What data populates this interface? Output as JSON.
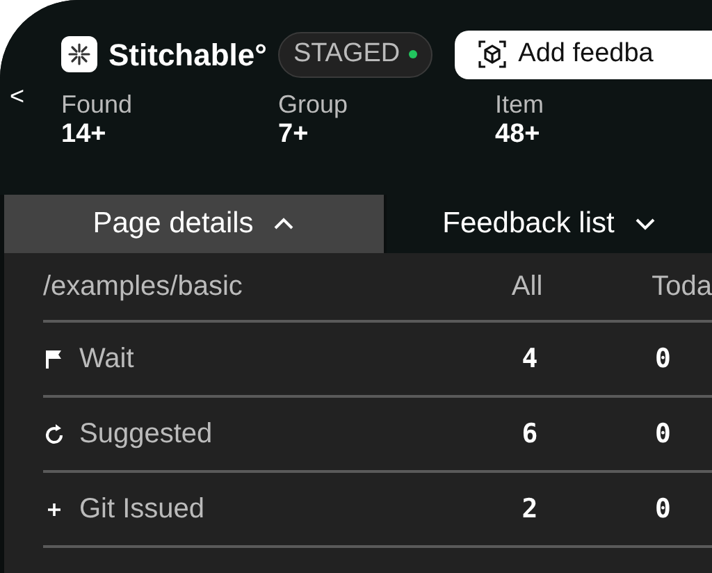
{
  "header": {
    "back_symbol": "<",
    "app_name": "Stitchable°",
    "badge": {
      "label": "STAGED",
      "color": "#22c55e"
    },
    "add_button": "Add feedba"
  },
  "stats": [
    {
      "label": "Found",
      "value": "14+"
    },
    {
      "label": "Group",
      "value": "7+"
    },
    {
      "label": "Item",
      "value": "48+"
    }
  ],
  "tabs": [
    {
      "label": "Page details",
      "selected": true,
      "expanded": true
    },
    {
      "label": "Feedback list",
      "selected": false,
      "expanded": false
    }
  ],
  "table": {
    "columns": [
      "/examples/basic",
      "All",
      "Toda"
    ],
    "rows": [
      {
        "kind": "flag",
        "label": "Wait",
        "all": "4",
        "today": "0"
      },
      {
        "kind": "refresh",
        "label": "Suggested",
        "all": "6",
        "today": "0"
      },
      {
        "kind": "plus",
        "label": "Git Issued",
        "all": "2",
        "today": "0"
      }
    ]
  }
}
